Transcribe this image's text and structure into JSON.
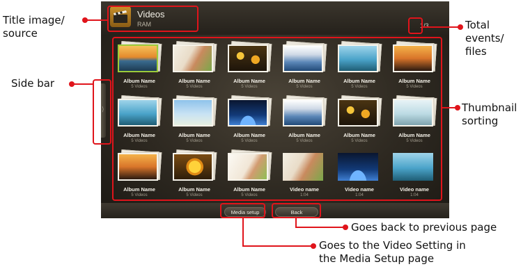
{
  "screen": {
    "title": "Videos",
    "source": "RAM",
    "page_count": "1/3",
    "sidebar_arrow": "⟩",
    "buttons": {
      "media_setup": "Media setup",
      "back": "Back"
    }
  },
  "grid": [
    {
      "name": "Album Name",
      "sub": "5 Videos",
      "scene": "sunset",
      "selected": true
    },
    {
      "name": "Album Name",
      "sub": "5 Videos",
      "scene": "girl"
    },
    {
      "name": "Album Name",
      "sub": "5 Videos",
      "scene": "flowers"
    },
    {
      "name": "Album Name",
      "sub": "5 Videos",
      "scene": "clouds"
    },
    {
      "name": "Album Name",
      "sub": "5 Videos",
      "scene": "reeds"
    },
    {
      "name": "Album Name",
      "sub": "5 Videos",
      "scene": "couple"
    },
    {
      "name": "Album Name",
      "sub": "5 Videos",
      "scene": "reeds"
    },
    {
      "name": "Album Name",
      "sub": "5 Videos",
      "scene": "windmill"
    },
    {
      "name": "Album Name",
      "sub": "5 Videos",
      "scene": "earth"
    },
    {
      "name": "Album Name",
      "sub": "5 Videos",
      "scene": "clouds"
    },
    {
      "name": "Album Name",
      "sub": "5 Videos",
      "scene": "flowers"
    },
    {
      "name": "Album Name",
      "sub": "5 Videos",
      "scene": "reeds-light"
    },
    {
      "name": "Album Name",
      "sub": "5 Videos",
      "scene": "couple"
    },
    {
      "name": "Album Name",
      "sub": "5 Videos",
      "scene": "flower-yellow"
    },
    {
      "name": "Album Name",
      "sub": "5 Videos",
      "scene": "girl-light"
    },
    {
      "name": "Video name",
      "sub": "1:04",
      "scene": "girl",
      "single": true
    },
    {
      "name": "Video name",
      "sub": "1:04",
      "scene": "earth",
      "single": true
    },
    {
      "name": "Video name",
      "sub": "1:04",
      "scene": "reeds",
      "single": true
    }
  ],
  "annotations": {
    "title": "Title image/\nsource",
    "sidebar": "Side bar",
    "total": "Total\nevents/\nfiles",
    "thumbnail": "Thumbnail\nsorting",
    "back": "Goes back to previous page",
    "media": "Goes to the Video Setting in\nthe Media Setup page"
  },
  "colors": {
    "annotation": "#e0141b",
    "selection": "#9ccc3a"
  },
  "icons": {
    "title": "clapperboard-icon"
  }
}
